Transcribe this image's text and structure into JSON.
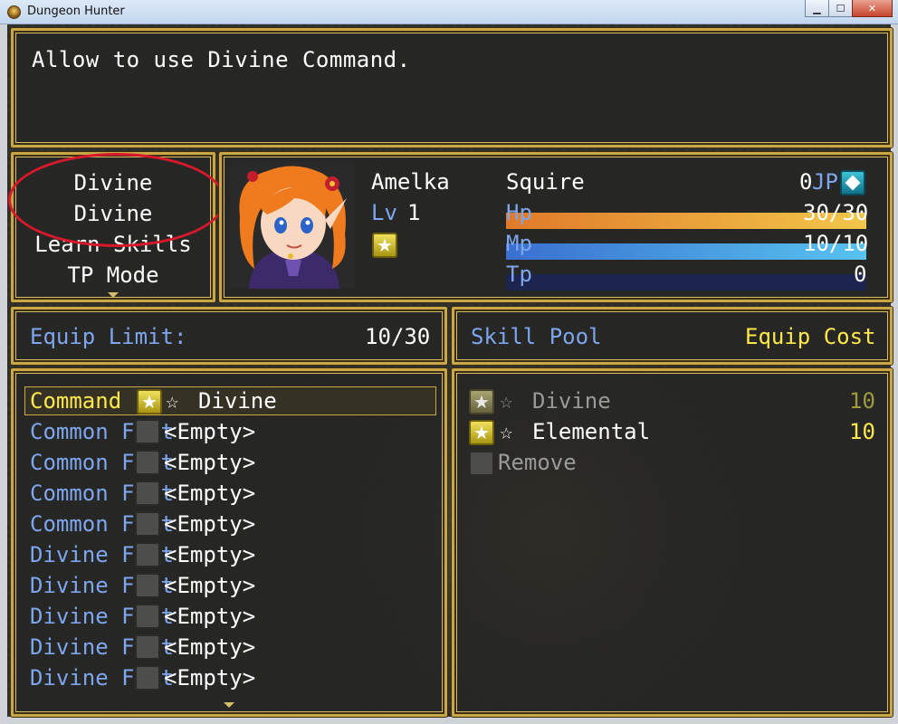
{
  "window": {
    "title": "Dungeon Hunter",
    "controls": {
      "minimize": "▁",
      "maximize": "☐",
      "close": "✕"
    }
  },
  "help": {
    "text": "Allow to use Divine Command."
  },
  "command_menu": {
    "items": [
      "Divine",
      "Divine",
      "Learn Skills",
      "TP Mode"
    ],
    "annotation": "red-ellipse-around-first-two-items"
  },
  "actor": {
    "name": "Amelka",
    "level_label": "Lv",
    "level": "1",
    "class": "Squire",
    "jp_value": "0",
    "jp_label": "JP",
    "hp_label": "Hp",
    "hp_value": "30/30",
    "hp_ratio": 1.0,
    "mp_label": "Mp",
    "mp_value": "10/10",
    "mp_ratio": 1.0,
    "tp_label": "Tp",
    "tp_value": "0",
    "tp_ratio": 0.0,
    "icons": [
      "star-badge-icon",
      "jp-gem-icon"
    ],
    "colors": {
      "hp_from": "#e07a2a",
      "hp_to": "#f2c64a",
      "mp_from": "#3a6fd0",
      "mp_to": "#57c3ef",
      "tp_track": "#1e2450"
    }
  },
  "equip_limit": {
    "label": "Equip Limit:",
    "value": "10/30"
  },
  "skill_pool_header": {
    "label": "Skill Pool",
    "cost_label": "Equip Cost"
  },
  "slots": [
    {
      "label": "Command",
      "star": "☆",
      "value": "Divine",
      "filled": true,
      "selected": true
    },
    {
      "label": "Common Feat",
      "value": "<Empty>",
      "filled": false
    },
    {
      "label": "Common Feat",
      "value": "<Empty>",
      "filled": false
    },
    {
      "label": "Common Feat",
      "value": "<Empty>",
      "filled": false
    },
    {
      "label": "Common Feat",
      "value": "<Empty>",
      "filled": false
    },
    {
      "label": "Divine Feat",
      "value": "<Empty>",
      "filled": false
    },
    {
      "label": "Divine Feat",
      "value": "<Empty>",
      "filled": false
    },
    {
      "label": "Divine Feat",
      "value": "<Empty>",
      "filled": false
    },
    {
      "label": "Divine Feat",
      "value": "<Empty>",
      "filled": false
    },
    {
      "label": "Divine Feat",
      "value": "<Empty>",
      "filled": false
    }
  ],
  "skill_pool": [
    {
      "star": "☆",
      "name": "Divine",
      "cost": "10",
      "enabled": false
    },
    {
      "star": "☆",
      "name": "Elemental",
      "cost": "10",
      "enabled": true
    },
    {
      "name": "Remove",
      "cost": "",
      "enabled": false
    }
  ],
  "colors": {
    "window_border": "#c9a646",
    "system_blue": "#7ea6ee",
    "gold_text": "#ffe84a",
    "annotation_red": "#d8192b"
  }
}
